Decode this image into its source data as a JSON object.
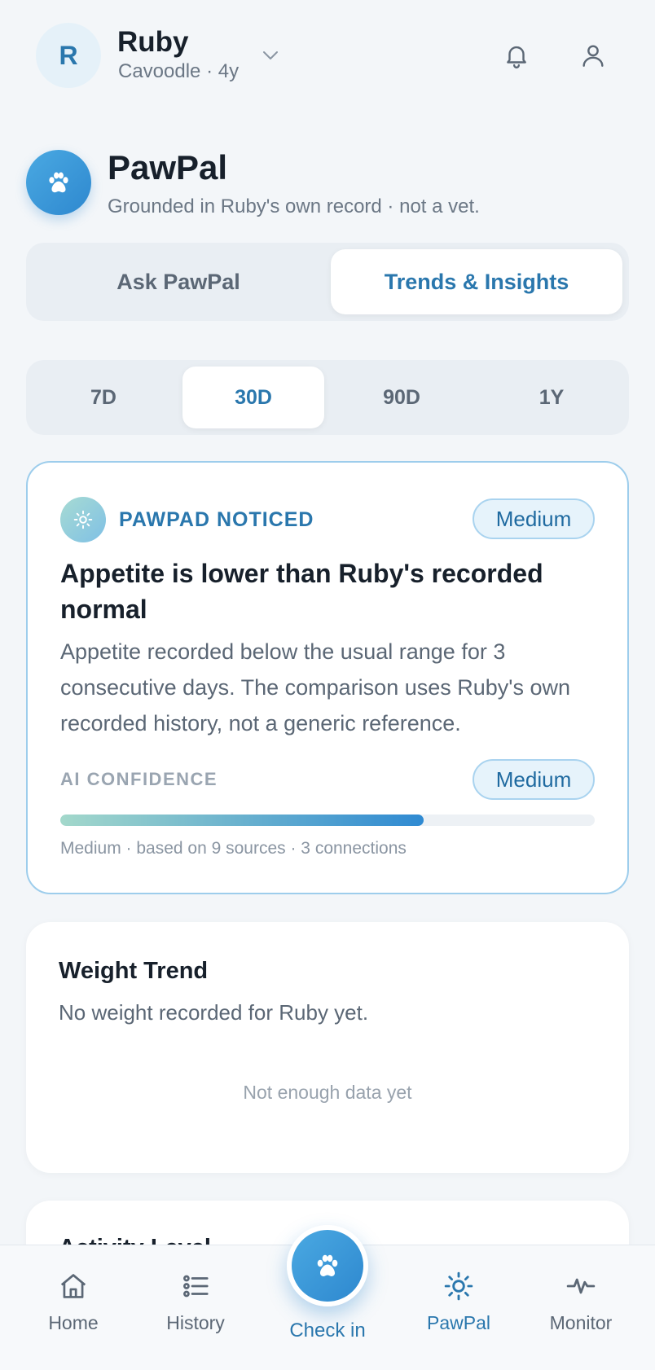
{
  "header": {
    "avatar_initial": "R",
    "pet_name": "Ruby",
    "pet_sub": "Cavoodle · 4y",
    "icons": [
      "chevron-down-icon",
      "bell-icon",
      "user-icon"
    ]
  },
  "app": {
    "title": "PawPal",
    "subtitle": "Grounded in Ruby's own record · not a vet.",
    "accent": "#2a77ad"
  },
  "tabs": [
    {
      "label": "Ask PawPal",
      "active": false
    },
    {
      "label": "Trends & Insights",
      "active": true
    }
  ],
  "ranges": [
    {
      "label": "7D",
      "active": false
    },
    {
      "label": "30D",
      "active": true
    },
    {
      "label": "90D",
      "active": false
    },
    {
      "label": "1Y",
      "active": false
    }
  ],
  "insight": {
    "eyebrow": "PAWPAD NOTICED",
    "severity": "Medium",
    "title": "Appetite is lower than Ruby's recorded normal",
    "body": "Appetite recorded below the usual range for 3 consecutive days. The comparison uses Ruby's own recorded history, not a generic reference.",
    "confidence_label": "AI CONFIDENCE",
    "confidence_level": "Medium",
    "confidence_fraction": 0.68,
    "confidence_note": "Medium · based on 9 sources · 3 connections"
  },
  "weight_card": {
    "title": "Weight Trend",
    "subtitle": "No weight recorded for Ruby yet.",
    "empty_state": "Not enough data yet"
  },
  "next_card": {
    "title": "Activity Level"
  },
  "nav": {
    "home": "Home",
    "history": "History",
    "checkin": "Check in",
    "pawpal": "PawPal",
    "monitor": "Monitor",
    "active": "PawPal"
  }
}
